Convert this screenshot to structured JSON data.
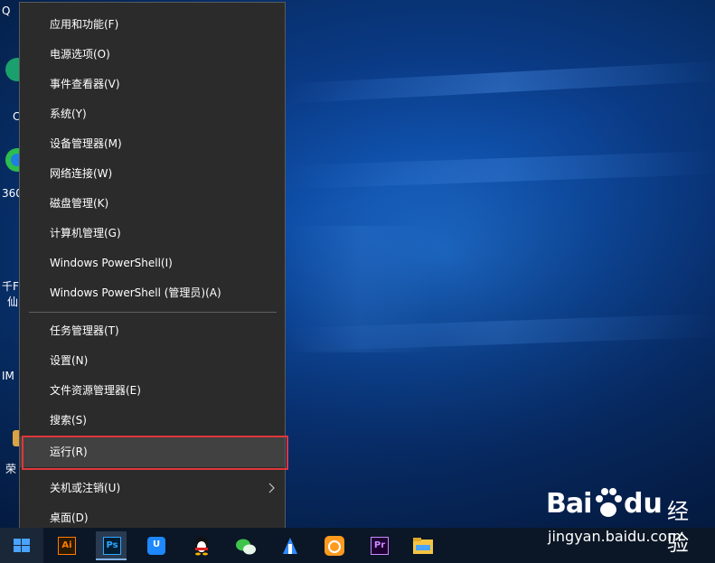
{
  "desktop": {
    "icon_labels": [
      "Q",
      "C",
      "360",
      "千F",
      "仙",
      "IM",
      "荣"
    ]
  },
  "context_menu": {
    "items_group1": [
      {
        "label": "应用和功能(F)"
      },
      {
        "label": "电源选项(O)"
      },
      {
        "label": "事件查看器(V)"
      },
      {
        "label": "系统(Y)"
      },
      {
        "label": "设备管理器(M)"
      },
      {
        "label": "网络连接(W)"
      },
      {
        "label": "磁盘管理(K)"
      },
      {
        "label": "计算机管理(G)"
      },
      {
        "label": "Windows PowerShell(I)"
      },
      {
        "label": "Windows PowerShell (管理员)(A)"
      }
    ],
    "items_group2": [
      {
        "label": "任务管理器(T)"
      },
      {
        "label": "设置(N)"
      },
      {
        "label": "文件资源管理器(E)"
      },
      {
        "label": "搜索(S)"
      },
      {
        "label": "运行(R)"
      }
    ],
    "items_group3": [
      {
        "label": "关机或注销(U)"
      },
      {
        "label": "桌面(D)"
      }
    ],
    "highlighted_item": "运行(R)",
    "highlight_color": "#e0363b"
  },
  "taskbar": {
    "start_icon": "windows-logo-icon",
    "apps": [
      {
        "name": "adobe-illustrator-icon",
        "glyph": "Ai",
        "color": "#ff7c00"
      },
      {
        "name": "adobe-photoshop-icon",
        "glyph": "Ps",
        "color": "#31a8ff"
      },
      {
        "name": "uu-icon",
        "glyph": "U",
        "color": "#1e88ff"
      },
      {
        "name": "qq-penguin-icon",
        "glyph": "",
        "color": "#ffffff"
      },
      {
        "name": "wechat-icon",
        "glyph": "",
        "color": "#3ec34b"
      },
      {
        "name": "ime-icon",
        "glyph": "",
        "color": "#2f8cff"
      },
      {
        "name": "uc-browser-icon",
        "glyph": "",
        "color": "#ff9a1f"
      },
      {
        "name": "adobe-premiere-icon",
        "glyph": "Pr",
        "color": "#c98cff"
      },
      {
        "name": "file-explorer-icon",
        "glyph": "",
        "color": "#f5c542"
      }
    ]
  },
  "watermark": {
    "brand_left": "Bai",
    "brand_right": "du",
    "product": "经验",
    "url": "jingyan.baidu.com"
  }
}
